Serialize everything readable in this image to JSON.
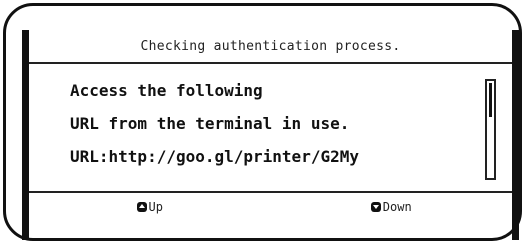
{
  "header": {
    "title": "Checking authentication process."
  },
  "message": {
    "lines": [
      "Access the following",
      "URL from the terminal in use.",
      "URL:http://goo.gl/printer/G2My"
    ]
  },
  "scrollbar": {
    "position_fraction": 0.0,
    "visible_fraction": 0.35
  },
  "footer": {
    "up": {
      "label": "Up",
      "icon": "up-key-icon"
    },
    "down": {
      "label": "Down",
      "icon": "down-key-icon"
    }
  }
}
